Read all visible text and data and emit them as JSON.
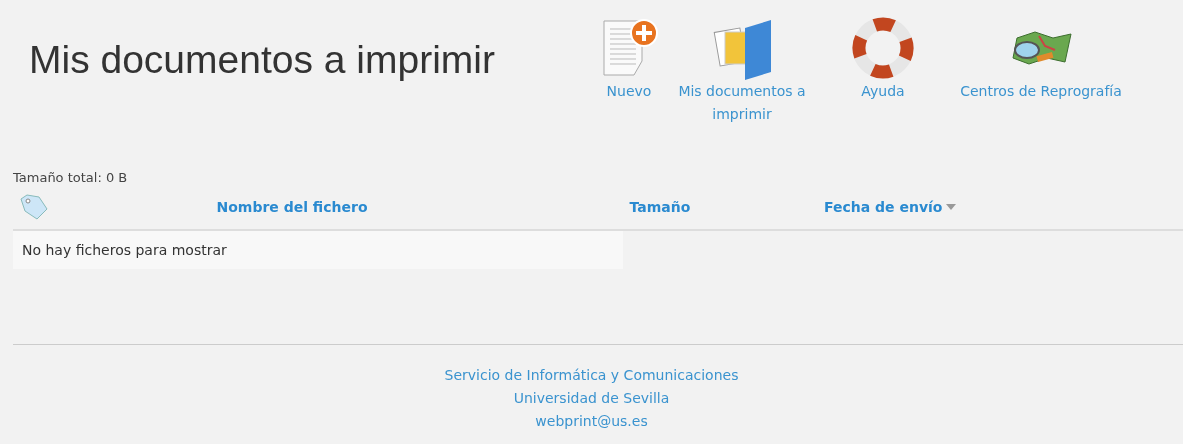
{
  "page_title": "Mis documentos a imprimir",
  "toolbar": [
    {
      "kind": "new",
      "label": "Nuevo"
    },
    {
      "kind": "documents",
      "label": "Mis documentos a imprimir"
    },
    {
      "kind": "help",
      "label": "Ayuda"
    },
    {
      "kind": "map",
      "label": "Centros de Reprografía"
    }
  ],
  "total_size": "Tamaño total: 0 B",
  "table": {
    "columns": [
      {
        "label": "Nombre del fichero",
        "sorted": false
      },
      {
        "label": "Tamaño",
        "sorted": false
      },
      {
        "label": "Fecha de envío",
        "sorted": true
      }
    ],
    "empty_message": "No hay ficheros para mostrar"
  },
  "footer": [
    "Servicio de Informática y Comunicaciones",
    "Universidad de Sevilla",
    "webprint@us.es"
  ]
}
